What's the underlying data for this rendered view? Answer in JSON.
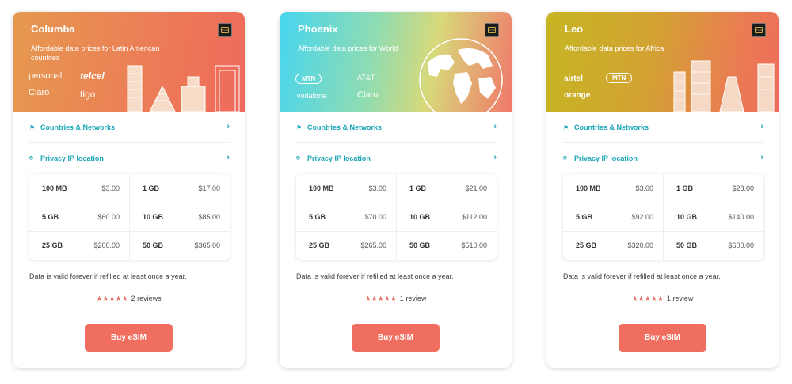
{
  "cards": [
    {
      "name": "Columba",
      "desc": "Affordable data prices for Latin American countries",
      "chip": "eSIM",
      "logos": [
        "personal",
        "telcel",
        "Claro",
        "tigo"
      ],
      "countries_label": "Countries & Networks",
      "privacy_label": "Privacy IP location",
      "plans": [
        {
          "size": "100 MB",
          "price": "$3.00"
        },
        {
          "size": "1 GB",
          "price": "$17.00"
        },
        {
          "size": "5 GB",
          "price": "$60.00"
        },
        {
          "size": "10 GB",
          "price": "$85.00"
        },
        {
          "size": "25 GB",
          "price": "$200.00"
        },
        {
          "size": "50 GB",
          "price": "$365.00"
        }
      ],
      "note": "Data is valid forever if refilled at least once a year.",
      "stars": "★★★★★",
      "reviews": "2 reviews",
      "buy_label": "Buy eSIM",
      "colors": {
        "from": "#e9904e",
        "to": "#ef6d5c"
      }
    },
    {
      "name": "Phoenix",
      "desc": "Affordable data prices for World",
      "chip": "eSIM",
      "logos": [
        "MTN",
        "AT&T",
        "vodafone",
        "Claro"
      ],
      "countries_label": "Countries & Networks",
      "privacy_label": "Privacy IP location",
      "plans": [
        {
          "size": "100 MB",
          "price": "$3.00"
        },
        {
          "size": "1 GB",
          "price": "$21.00"
        },
        {
          "size": "5 GB",
          "price": "$70.00"
        },
        {
          "size": "10 GB",
          "price": "$112.00"
        },
        {
          "size": "25 GB",
          "price": "$265.00"
        },
        {
          "size": "50 GB",
          "price": "$510.00"
        }
      ],
      "note": "Data is valid forever if refilled at least once a year.",
      "stars": "★★★★★",
      "reviews": "1 review",
      "buy_label": "Buy eSIM",
      "colors": {
        "from": "#47d4ef",
        "to": "#f07160"
      }
    },
    {
      "name": "Leo",
      "desc": "Affordable data prices for Africa",
      "chip": "eSIM",
      "logos": [
        "airtel",
        "MTN",
        "orange"
      ],
      "countries_label": "Countries & Networks",
      "privacy_label": "Privacy IP location",
      "plans": [
        {
          "size": "100 MB",
          "price": "$3.00"
        },
        {
          "size": "1 GB",
          "price": "$28.00"
        },
        {
          "size": "5 GB",
          "price": "$92.00"
        },
        {
          "size": "10 GB",
          "price": "$140.00"
        },
        {
          "size": "25 GB",
          "price": "$320.00"
        },
        {
          "size": "50 GB",
          "price": "$600.00"
        }
      ],
      "note": "Data is valid forever if refilled at least once a year.",
      "stars": "★★★★★",
      "reviews": "1 review",
      "buy_label": "Buy eSIM",
      "colors": {
        "from": "#c8b421",
        "to": "#ef6d5c"
      }
    }
  ]
}
